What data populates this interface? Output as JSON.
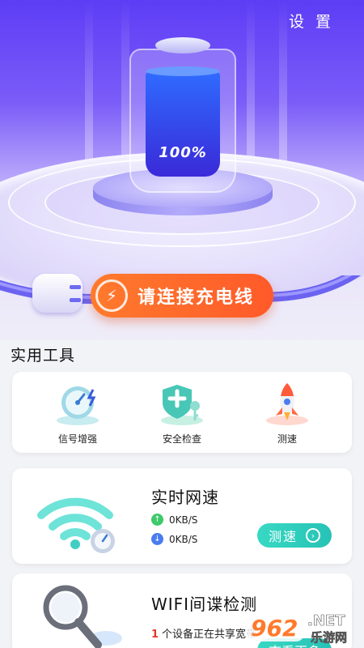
{
  "header": {
    "settings_label": "设 置"
  },
  "battery": {
    "percent_label": "100%",
    "level": 1.0
  },
  "charge_prompt": {
    "label": "请连接充电线"
  },
  "tools": {
    "section_title": "实用工具",
    "items": [
      {
        "label": "信号增强",
        "icon": "signal-speedometer-icon"
      },
      {
        "label": "安全检查",
        "icon": "shield-key-icon"
      },
      {
        "label": "测速",
        "icon": "rocket-icon"
      }
    ]
  },
  "speed_card": {
    "title": "实时网速",
    "upload": "0KB/S",
    "download": "0KB/S",
    "button_label": "测速",
    "colors": {
      "upload": "#3ec96b",
      "download": "#4a7cf0",
      "button": "#2ec9bb"
    }
  },
  "spy_card": {
    "title": "WIFI间谍检测",
    "device_count": "1",
    "device_text": "个设备正在共享宽带",
    "button_label": "查看更多"
  },
  "watermark": {
    "logo_text": "962",
    "net_text": ".NET",
    "site_text": "乐游网"
  },
  "colors": {
    "hero_top": "#5d3df5",
    "accent_orange": "#ff5a2a",
    "teal": "#2ec9bb"
  }
}
